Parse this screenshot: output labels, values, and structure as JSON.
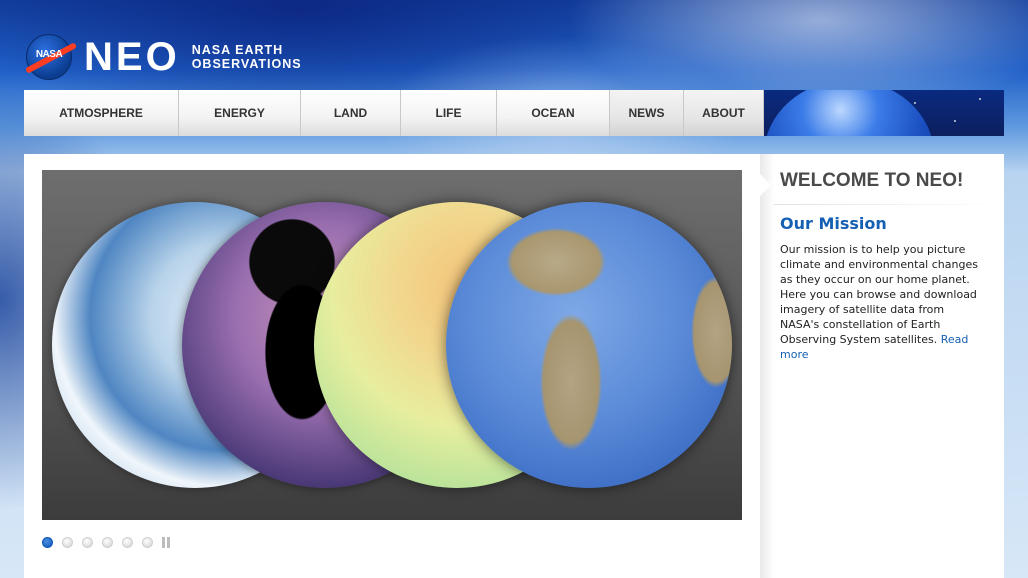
{
  "header": {
    "logo_agency": "NASA",
    "logo_title": "NEO",
    "logo_sub_line1": "NASA EARTH",
    "logo_sub_line2": "OBSERVATIONS"
  },
  "nav": {
    "items": [
      {
        "label": "ATMOSPHERE"
      },
      {
        "label": "ENERGY"
      },
      {
        "label": "LAND"
      },
      {
        "label": "LIFE"
      },
      {
        "label": "OCEAN"
      },
      {
        "label": "NEWS"
      },
      {
        "label": "ABOUT"
      }
    ]
  },
  "slideshow": {
    "slide_count": 6,
    "active_slide": 1,
    "globes": [
      "cloud-cover-globe",
      "night-lights-globe",
      "temperature-globe",
      "bathymetry-globe"
    ]
  },
  "sidebar": {
    "welcome_title": "WELCOME TO NEO!",
    "mission_title": "Our Mission",
    "mission_text": "Our mission is to help you picture climate and environmental changes as they occur on our home planet. Here you can browse and download imagery of satellite data from NASA's constellation of Earth Observing System satellites.",
    "read_more": "Read more"
  },
  "colors": {
    "link": "#1660b4",
    "active_dot": "#0e57b8",
    "nasa_red": "#fc3d21"
  }
}
